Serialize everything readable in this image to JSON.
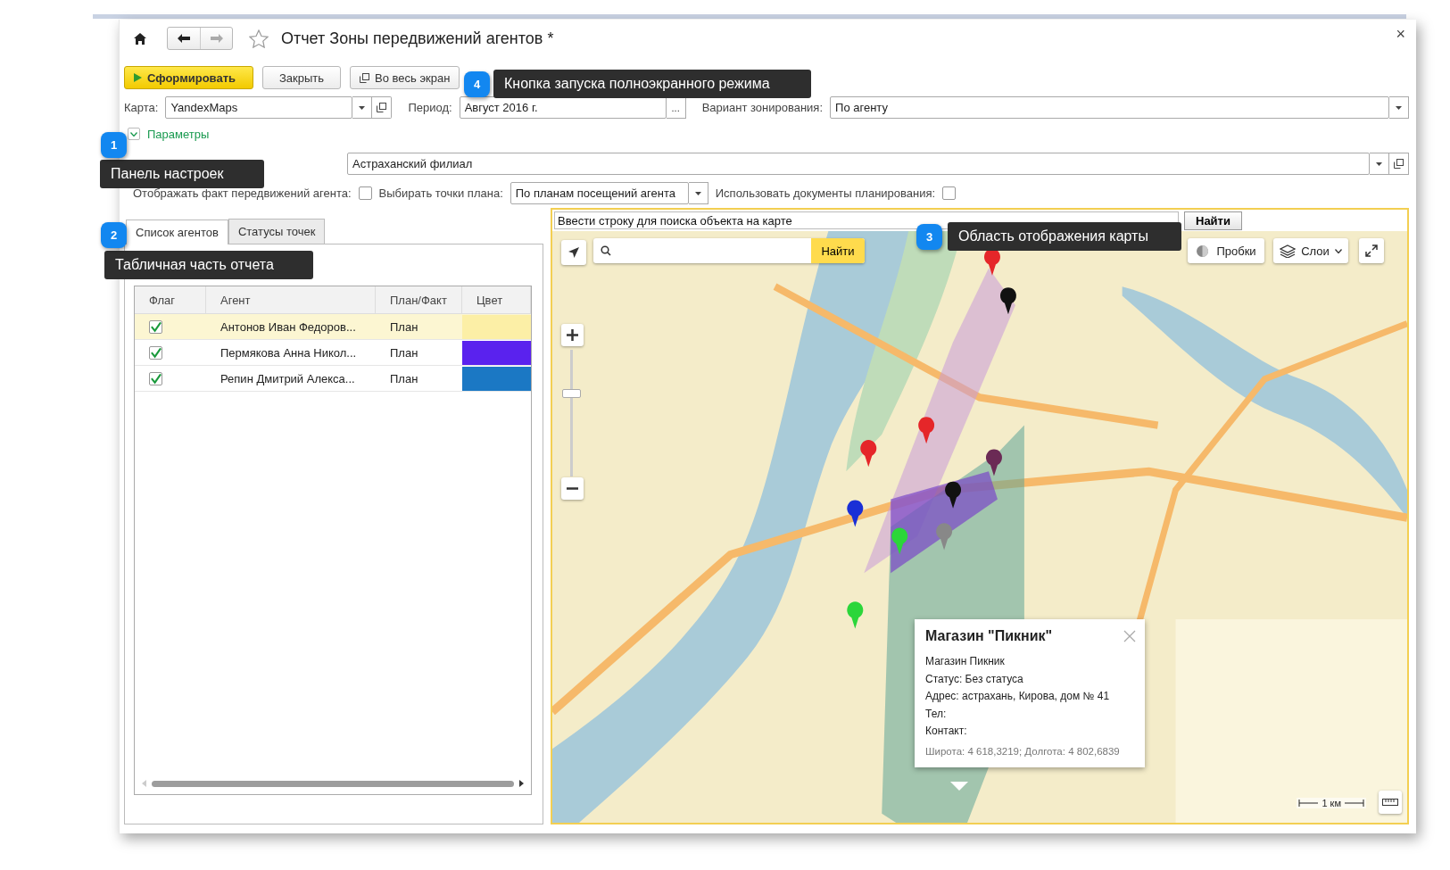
{
  "window": {
    "title": "Отчет Зоны передвижений агентов *",
    "close": "×"
  },
  "toolbar": [
    {
      "kind": "primary",
      "label": "Сформировать"
    },
    {
      "kind": "plain",
      "label": "Закрыть"
    },
    {
      "kind": "fullscreen",
      "label": "Во весь экран"
    }
  ],
  "fields": {
    "map": {
      "label": "Карта:",
      "value": "YandexMaps"
    },
    "period": {
      "label": "Период:",
      "value": "Август 2016 г.",
      "button": "..."
    },
    "zoning": {
      "label": "Вариант зонирования:",
      "value": "По агенту"
    }
  },
  "parameters": {
    "label": "Параметры",
    "expanded": true,
    "division": "Астраханский филиал",
    "options": [
      {
        "kind": "checkbox",
        "label": "Отображать факт передвижений агента:",
        "checked": false
      },
      {
        "kind": "select",
        "label": "Выбирать точки плана:",
        "value": "По планам посещений агента"
      },
      {
        "kind": "checkbox",
        "label": "Использовать документы планирования:",
        "checked": false
      }
    ]
  },
  "tabs": [
    {
      "label": "Список агентов",
      "selected": true
    },
    {
      "label": "Статусы точек",
      "selected": false
    }
  ],
  "table": {
    "columns": [
      "Флаг",
      "Агент",
      "План/Факт",
      "Цвет"
    ],
    "rows": [
      {
        "checked": true,
        "agent": "Антонов Иван Федоров...",
        "plan_fact": "План",
        "color": "#fcefa6",
        "selected": true
      },
      {
        "checked": true,
        "agent": "Пермякова Анна Никол...",
        "plan_fact": "План",
        "color": "#5a22ee",
        "selected": false
      },
      {
        "checked": true,
        "agent": "Репин Дмитрий Алекса...",
        "plan_fact": "План",
        "color": "#1b78c4",
        "selected": false
      }
    ]
  },
  "map": {
    "search": {
      "value": "Ввести строку для поиска объекта на карте",
      "button": "Найти"
    },
    "inner_search": {
      "button": "Найти"
    },
    "traffic": "Пробки",
    "layers": "Слои",
    "zoom": {
      "level": 0.67
    },
    "scale": "1 км",
    "popup": {
      "title": "Магазин \"Пикник\"",
      "lines": [
        "Магазин Пикник",
        "Статус: Без статуса",
        "Адрес: астрахань, Кирова, дом № 41",
        "Тел:",
        "Контакт:"
      ],
      "coords": "Широта: 4 618,3219; Долгота: 4 802,6839"
    }
  },
  "callouts": [
    {
      "number": "1",
      "text": "Панель настроек"
    },
    {
      "number": "2",
      "text": "Табличная часть отчета"
    },
    {
      "number": "3",
      "text": "Область отображения карты"
    },
    {
      "number": "4",
      "text": "Кнопка запуска полноэкранного режима"
    }
  ]
}
